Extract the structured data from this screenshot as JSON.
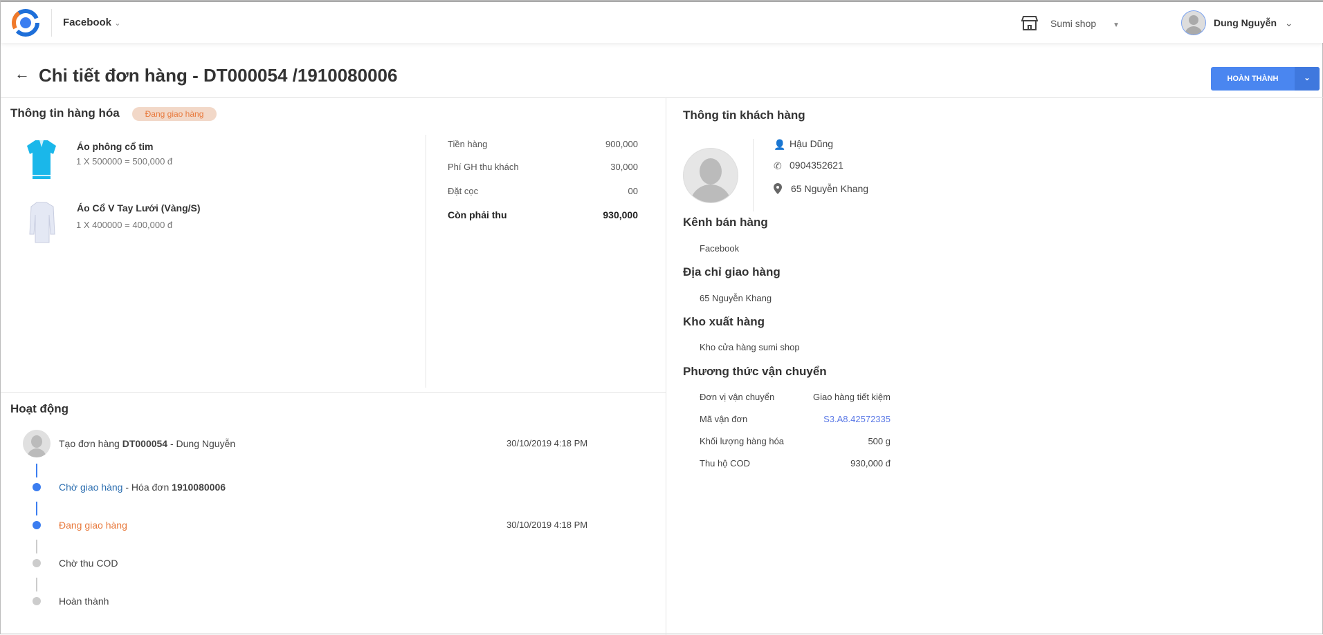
{
  "header": {
    "channel": "Facebook",
    "shop": "Sumi shop",
    "user": "Dung Nguyễn"
  },
  "page": {
    "title": "Chi tiết đơn hàng - DT000054 /1910080006",
    "complete_button": "HOÀN THÀNH"
  },
  "goods": {
    "title": "Thông tin hàng hóa",
    "status": "Đang giao hàng",
    "items": [
      {
        "name": "Áo phông cổ tim",
        "price": "1 X 500000 = 500,000 đ"
      },
      {
        "name": "Áo Cổ V Tay Lưới (Vàng/S)",
        "price": "1 X 400000 = 400,000 đ"
      }
    ],
    "summary": [
      {
        "label": "Tiền hàng",
        "value": "900,000"
      },
      {
        "label": "Phí GH thu khách",
        "value": "30,000"
      },
      {
        "label": "Đặt cọc",
        "value": "00"
      },
      {
        "label": "Còn phải thu",
        "value": "930,000"
      }
    ]
  },
  "activity": {
    "title": "Hoạt động",
    "created": {
      "prefix": "Tạo đơn hàng",
      "code": "DT000054",
      "suffix": "- Dung Nguyễn",
      "time": "30/10/2019 4:18 PM"
    },
    "waiting": {
      "status": "Chờ giao hàng",
      "mid": "- Hóa đơn",
      "code": "1910080006"
    },
    "shipping": {
      "status": "Đang giao hàng",
      "time": "30/10/2019 4:18 PM"
    },
    "cod": "Chờ thu COD",
    "done": "Hoàn thành"
  },
  "customer": {
    "title": "Thông tin khách hàng",
    "name": "Hậu Dũng",
    "phone": "0904352621",
    "address": "65 Nguyễn Khang"
  },
  "channel": {
    "title": "Kênh bán hàng",
    "value": "Facebook"
  },
  "delivery_address": {
    "title": "Địa chỉ giao hàng",
    "value": "65 Nguyễn Khang"
  },
  "warehouse": {
    "title": "Kho xuất hàng",
    "value": "Kho cửa hàng sumi shop"
  },
  "shipping_method": {
    "title": "Phương thức vận chuyển",
    "rows": [
      {
        "label": "Đơn vị vận chuyển",
        "value": "Giao hàng tiết kiệm"
      },
      {
        "label": "Mã vận đơn",
        "value": "S3.A8.42572335"
      },
      {
        "label": "Khối lượng hàng hóa",
        "value": "500 g"
      },
      {
        "label": "Thu hộ COD",
        "value": "930,000 đ"
      }
    ]
  }
}
